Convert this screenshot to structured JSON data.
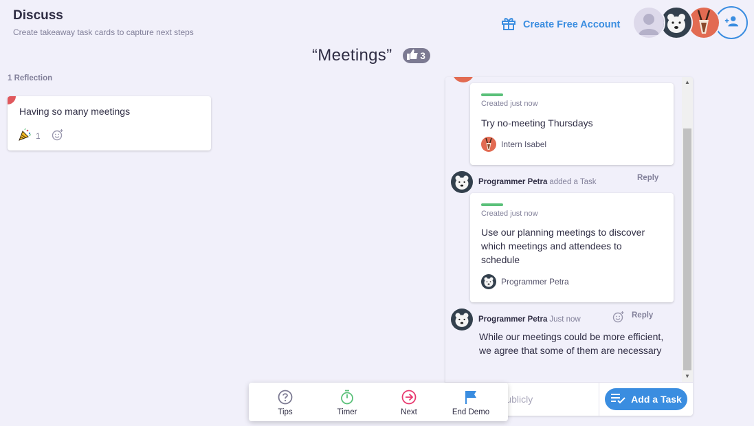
{
  "header": {
    "title": "Discuss",
    "subtitle": "Create takeaway task cards to capture next steps",
    "create_account": "Create Free Account"
  },
  "topic": {
    "title": "“Meetings”",
    "votes": "3"
  },
  "reflections": {
    "count_label": "1 Reflection",
    "card": {
      "text": "Having so many meetings",
      "reaction_count": "1"
    }
  },
  "thread": {
    "task1": {
      "created": "Created just now",
      "text": "Try no-meeting Thursdays",
      "owner": "Intern Isabel"
    },
    "comment1": {
      "author": "Programmer Petra",
      "meta": "added a Task",
      "reply": "Reply"
    },
    "task2": {
      "created": "Created just now",
      "text": "Use our planning meetings to discover which meetings and attendees to schedule",
      "owner": "Programmer Petra"
    },
    "comment2": {
      "author": "Programmer Petra",
      "meta": "Just now",
      "reply": "Reply",
      "text": "While our meetings could be more efficient, we agree that some of them are necessary"
    }
  },
  "composer": {
    "placeholder": "Comment publicly",
    "add_task": "Add a Task"
  },
  "bottom_bar": {
    "tips": "Tips",
    "timer": "Timer",
    "next": "Next",
    "end_demo": "End Demo"
  },
  "colors": {
    "accent": "#3a8de0",
    "task_status": "#5ac079",
    "reflection_corner": "#e0585d",
    "next": "#e8396f",
    "timer": "#5ac079"
  }
}
